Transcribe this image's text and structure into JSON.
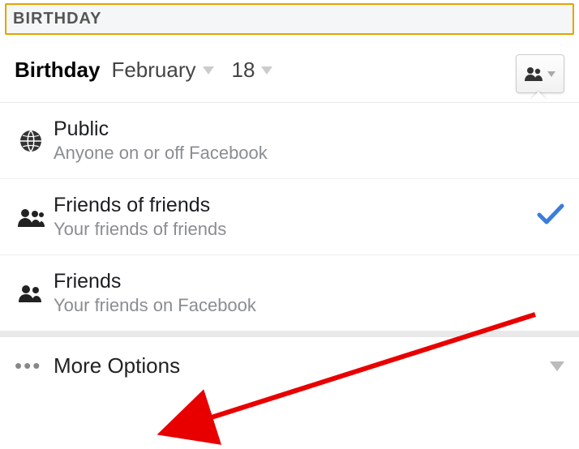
{
  "header": {
    "section_label": "BIRTHDAY"
  },
  "birthday": {
    "label": "Birthday",
    "month": "February",
    "day": "18"
  },
  "audience_menu": {
    "items": [
      {
        "icon": "globe-icon",
        "title": "Public",
        "subtitle": "Anyone on or off Facebook",
        "selected": false
      },
      {
        "icon": "friends-of-friends-icon",
        "title": "Friends of friends",
        "subtitle": "Your friends of friends",
        "selected": true
      },
      {
        "icon": "friends-icon",
        "title": "Friends",
        "subtitle": "Your friends on Facebook",
        "selected": false
      }
    ],
    "more_label": "More Options"
  },
  "annotation": {
    "arrow_color": "#e80000"
  }
}
